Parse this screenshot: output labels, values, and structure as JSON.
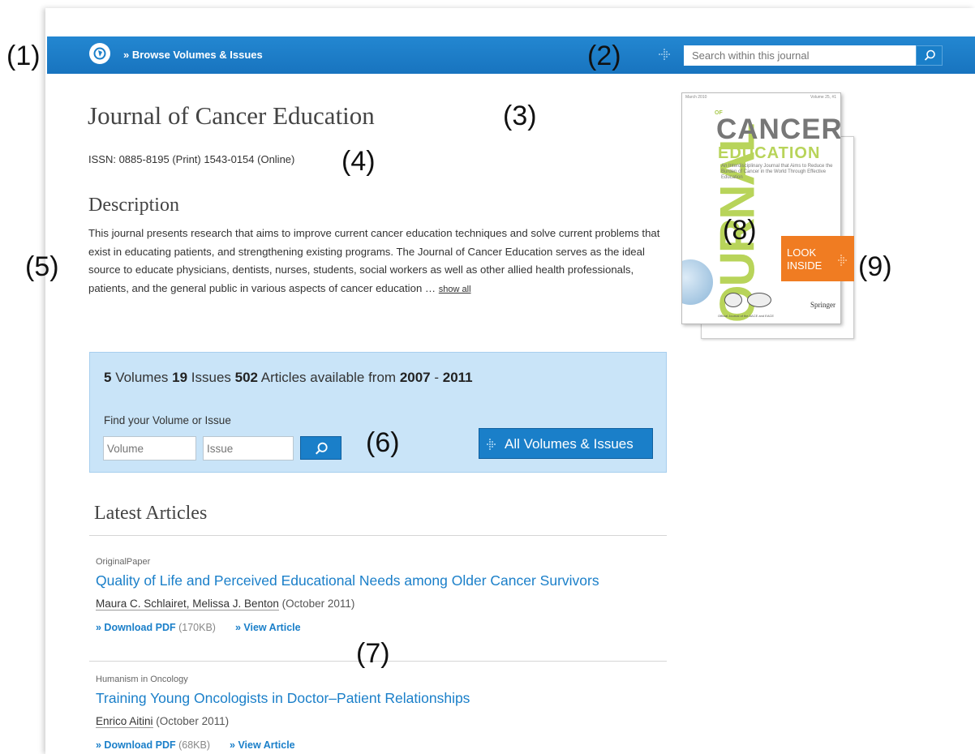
{
  "callouts": [
    "(1)",
    "(2)",
    "(3)",
    "(4)",
    "(5)",
    "(6)",
    "(7)",
    "(8)",
    "(9)"
  ],
  "topbar": {
    "browse_label": "» Browse Volumes & Issues",
    "search_placeholder": "Search within this journal",
    "browse_icon": "compass-icon",
    "search_icon": "magnifier-icon"
  },
  "journal": {
    "title": "Journal of Cancer Education",
    "issn": "ISSN: 0885-8195 (Print) 1543-0154 (Online)"
  },
  "description": {
    "heading": "Description",
    "text": "This journal presents research that aims to improve current cancer education techniques and solve current problems that exist in educating patients, and strengthening existing programs. The Journal of Cancer Education serves as the ideal source to educate physicians, dentists, nurses, students, social workers as well as other allied health professionals, patients, and the general public in various aspects of cancer education … ",
    "show_all": "show all"
  },
  "volumes": {
    "volumes_count": "5",
    "volumes_label": " Volumes ",
    "issues_count": "19",
    "issues_label": " Issues ",
    "articles_count": "502",
    "articles_label": " Articles available from ",
    "year_from": "2007",
    "dash": " - ",
    "year_to": "2011",
    "find_label": "Find your Volume or Issue",
    "volume_placeholder": "Volume",
    "issue_placeholder": "Issue",
    "all_button": "All Volumes & Issues"
  },
  "latest": {
    "heading": "Latest Articles",
    "articles": [
      {
        "type": "OriginalPaper",
        "title": "Quality of Life and Perceived Educational Needs among Older Cancer Survivors",
        "authors": "Maura C. Schlairet, Melissa J. Benton",
        "date": " (October 2011)",
        "download": "» Download PDF",
        "size": " (170KB)",
        "view": "» View Article"
      },
      {
        "type": "Humanism in Oncology",
        "title": "Training Young Oncologists in Doctor–Patient Relationships",
        "authors": "Enrico Aitini",
        "date": " (October 2011)",
        "download": "» Download PDF",
        "size": " (68KB)",
        "view": "» View Article"
      }
    ]
  },
  "cover": {
    "date": "March 2010",
    "volume": "Volume 25, #1",
    "journal_word": "JOURNAL",
    "of_word": "OF",
    "cancer_word": "CANCER",
    "education_word": "EDUCATION",
    "blurb": "An Interdisciplinary Journal that Aims to Reduce the Burden of Cancer in the World Through Effective Education",
    "publisher": "Springer",
    "official": "Official Journal of the AACE and EACE",
    "look_inside": [
      "LOOK",
      "INSIDE"
    ]
  },
  "colors": {
    "brand_blue": "#1a7fc9",
    "box_blue": "#c9e4f8",
    "look_orange": "#f07c22",
    "cover_green": "#b8d45a"
  }
}
